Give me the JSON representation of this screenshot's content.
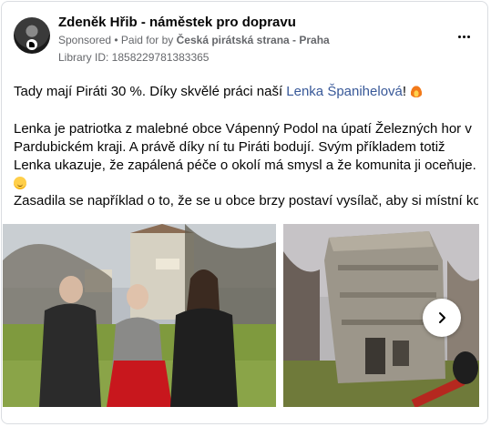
{
  "post": {
    "author": "Zdeněk Hřib - náměstek pro dopravu",
    "sponsored": "Sponsored",
    "separator": " • ",
    "paid_for_prefix": "Paid for by ",
    "paid_for_by": "Česká pirátská strana - Praha",
    "library_id": "Library ID: 1858229781383365",
    "text_line1_before": "Tady mají Piráti 30 %. Díky skvělé práci naší ",
    "mention": "Lenka Španihelová",
    "text_line1_after": "! ",
    "text_para2": "Lenka je patriotka z malebné obce Vápenný Podol na úpatí Železných hor v Pardubickém kraji. A právě díky ní tu Piráti bodují. Svým příkladem totiž Lenka ukazuje, že zapálená péče o okolí má smysl a že komunita ji oceňuje. ",
    "text_para3": "Zasadila se například o to, že se u obce brzy postaví vysílač, aby si místní konečn…"
  },
  "icons": {
    "more": "more-horizontal-icon",
    "next": "chevron-right-icon",
    "emoji1": "fire-emoji-icon",
    "emoji2": "smiling-face-emoji-icon"
  },
  "colors": {
    "text": "#050505",
    "secondary": "#65676b",
    "link": "#385898",
    "border": "#dadde1"
  }
}
